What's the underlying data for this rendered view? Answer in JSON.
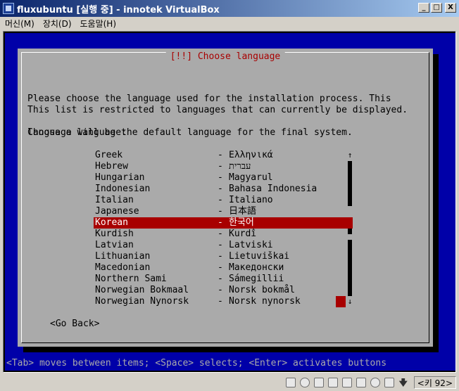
{
  "window": {
    "title": "fluxubuntu [실행 중] - innotek VirtualBox",
    "buttons": {
      "minimize": "_",
      "maximize": "□",
      "close": "X"
    }
  },
  "menubar": [
    {
      "label": "머신(M)"
    },
    {
      "label": "장치(D)"
    },
    {
      "label": "도움말(H)"
    }
  ],
  "installer": {
    "dialog_title": "[!!] Choose language",
    "intro_line1": "Please choose the language used for the installation process. This",
    "intro_line2": "language will be the default language for the final system.",
    "restrict": "This list is restricted to languages that can currently be displayed.",
    "prompt": "Choose a language:",
    "languages": [
      {
        "en": "Greek",
        "dash": "-",
        "native": "Ελληνικά"
      },
      {
        "en": "Hebrew",
        "dash": "-",
        "native": "עברית"
      },
      {
        "en": "Hungarian",
        "dash": "-",
        "native": "Magyarul"
      },
      {
        "en": "Indonesian",
        "dash": "-",
        "native": "Bahasa Indonesia"
      },
      {
        "en": "Italian",
        "dash": "-",
        "native": "Italiano"
      },
      {
        "en": "Japanese",
        "dash": "-",
        "native": "日本語"
      },
      {
        "en": "Korean",
        "dash": "-",
        "native": "한국어"
      },
      {
        "en": "Kurdish",
        "dash": "-",
        "native": "Kurdî"
      },
      {
        "en": "Latvian",
        "dash": "-",
        "native": "Latviski"
      },
      {
        "en": "Lithuanian",
        "dash": "-",
        "native": "Lietuviškai"
      },
      {
        "en": "Macedonian",
        "dash": "-",
        "native": "Македонски"
      },
      {
        "en": "Northern Sami",
        "dash": "-",
        "native": "Sámegillii"
      },
      {
        "en": "Norwegian Bokmaal",
        "dash": "-",
        "native": "Norsk bokmål"
      },
      {
        "en": "Norwegian Nynorsk",
        "dash": "-",
        "native": "Norsk nynorsk"
      }
    ],
    "selected_index": 6,
    "scroll_up": "↑",
    "scroll_down": "↓",
    "go_back": "<Go Back>",
    "status_line": "<Tab> moves between items; <Space> selects; <Enter> activates buttons"
  },
  "statusbar": {
    "icons": [
      "hard-disk-icon",
      "cd-icon",
      "floppy-icon",
      "network-icon",
      "usb-icon",
      "shared-folder-icon",
      "vrdp-icon",
      "mouse-integration-icon",
      "keyboard-capture-icon"
    ],
    "host_key": "<키 92>"
  },
  "colors": {
    "title_gradient_start": "#0a246a",
    "title_gradient_end": "#a6caf0",
    "screen_blue": "#0000a8",
    "dialog_gray": "#aaaaaa",
    "highlight_red": "#a80000"
  }
}
